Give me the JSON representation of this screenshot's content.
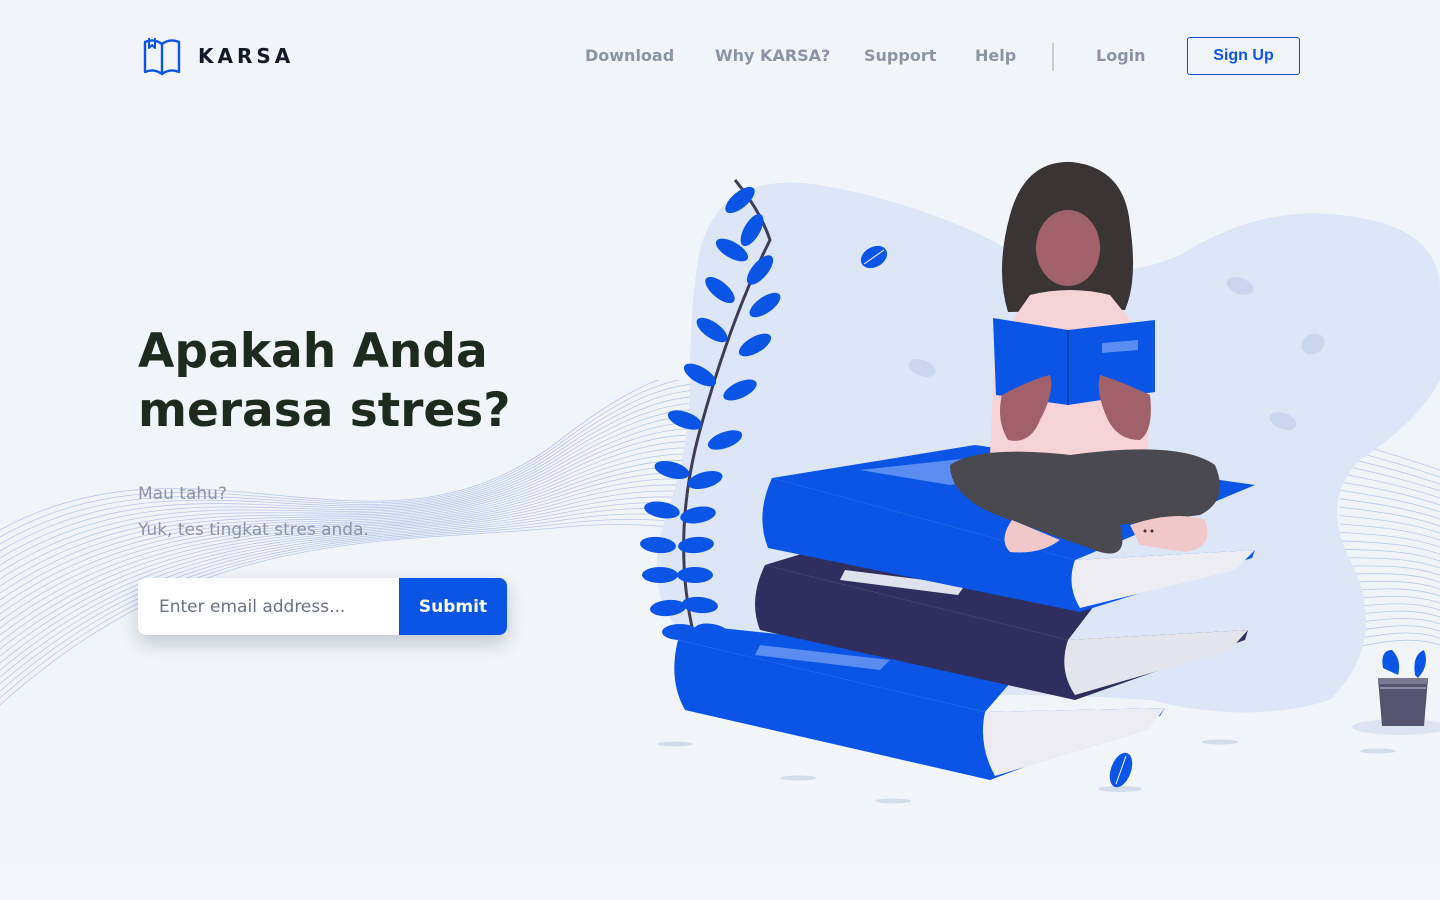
{
  "brand": {
    "name": "KARSA",
    "accent": "#0a55e6"
  },
  "nav": {
    "links": [
      "Download",
      "Why KARSA?",
      "Support",
      "Help"
    ],
    "login": "Login",
    "signup": "Sign Up"
  },
  "hero": {
    "title_line1": "Apakah Anda",
    "title_line2": "merasa stres?",
    "sub1": "Mau tahu?",
    "sub2": "Yuk, tes tingkat stres anda.",
    "email_placeholder": "Enter email address...",
    "submit": "Submit"
  },
  "icons": [
    "book-logo-icon",
    "plant-icon",
    "leaf-icon",
    "potted-plant-icon"
  ]
}
